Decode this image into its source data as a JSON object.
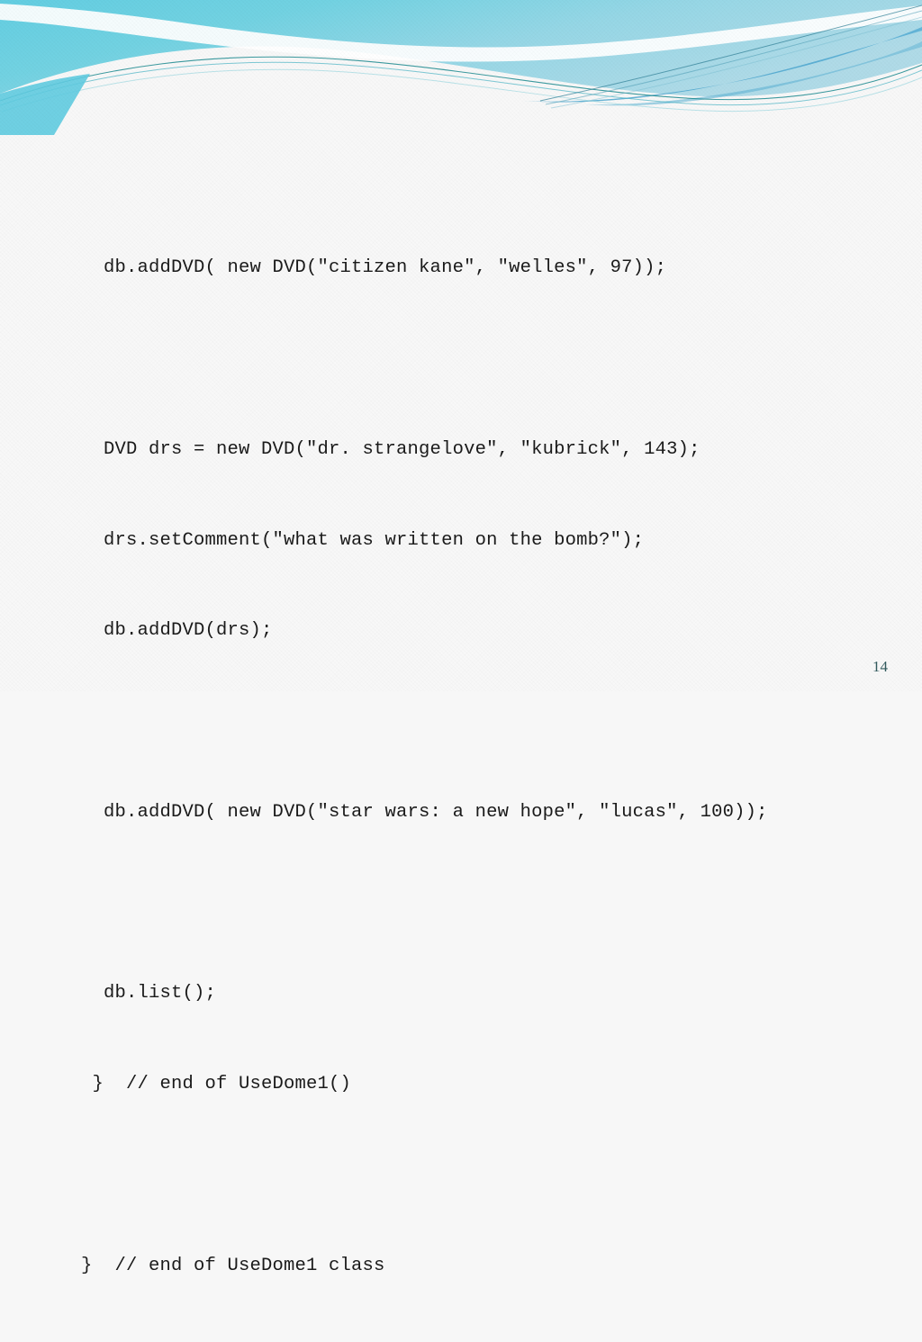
{
  "slide": {
    "background_color": "#f8f8f8",
    "accent_color": "#6fd0e0",
    "accent_color_secondary": "#4fb6d8",
    "accent_color_line": "#1d7f8c",
    "page_number": "14",
    "page_number_color": "#31595c"
  },
  "banner": {
    "name": "decorative-wave-banner",
    "colors": {
      "gradient_left": "#6fd0e0",
      "gradient_mid": "#8fd9e6",
      "gradient_right": "#a9dbe8",
      "ribbon_blue": "#59b4d9",
      "ribbon_blue_dark": "#2f8fb5",
      "thin_line_teal": "#1b8a8f",
      "swoosh_white": "#ffffff"
    }
  },
  "code": {
    "language": "java",
    "lines": [
      "  db.addDVD( new DVD(\"citizen kane\", \"welles\", 97));",
      "",
      "  DVD drs = new DVD(\"dr. strangelove\", \"kubrick\", 143);",
      "  drs.setComment(\"what was written on the bomb?\");",
      "  db.addDVD(drs);",
      "",
      "  db.addDVD( new DVD(\"star wars: a new hope\", \"lucas\", 100));",
      "",
      "  db.list();",
      " }  // end of UseDome1()",
      "",
      "}  // end of UseDome1 class"
    ]
  }
}
